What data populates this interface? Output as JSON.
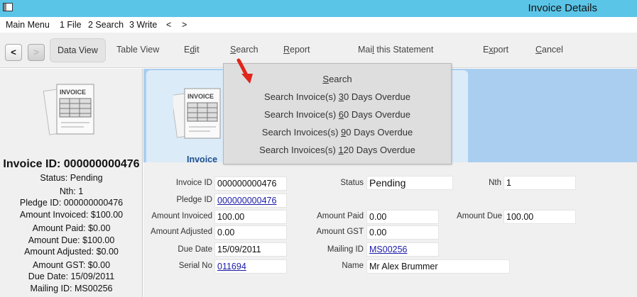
{
  "window": {
    "title": "Invoice Details"
  },
  "menu": [
    {
      "label": "Main Menu"
    },
    {
      "label": "1 File"
    },
    {
      "label": "2 Search"
    },
    {
      "label": "3 Write"
    },
    {
      "label": "<"
    },
    {
      "label": ">"
    }
  ],
  "toolbar": {
    "back": "<",
    "forward": ">",
    "data_view": "Data View",
    "table_view": "Table View",
    "edit_pre": "E",
    "edit_u": "d",
    "edit_post": "it",
    "search_u": "S",
    "search_post": "earch",
    "report_u": "R",
    "report_post": "eport",
    "mail_pre": "Mai",
    "mail_u": "l",
    "mail_post": " this Statement",
    "export_pre": "E",
    "export_u": "x",
    "export_post": "port",
    "cancel_u": "C",
    "cancel_post": "ancel"
  },
  "left_summary": {
    "invoice_id": "Invoice ID: 000000000476",
    "lines": [
      "Status: Pending",
      "Nth: 1",
      "Pledge ID: 000000000476",
      "Amount Invoiced: $100.00",
      "Amount Paid: $0.00",
      "Amount Due: $100.00",
      "Amount Adjusted: $0.00",
      "Amount GST: $0.00",
      "Due Date: 15/09/2011",
      "Mailing ID: MS00256"
    ]
  },
  "tab": {
    "label": "Invoice"
  },
  "icon_text": "INVOICE",
  "form": {
    "invoice_id": {
      "label": "Invoice ID",
      "value": "000000000476"
    },
    "status": {
      "label": "Status",
      "value": "Pending"
    },
    "nth": {
      "label": "Nth",
      "value": "1"
    },
    "pledge_id": {
      "label": "Pledge ID",
      "value": "000000000476"
    },
    "amount_invoiced": {
      "label": "Amount Invoiced",
      "value": "100.00"
    },
    "amount_paid": {
      "label": "Amount Paid",
      "value": "0.00"
    },
    "amount_due": {
      "label": "Amount Due",
      "value": "100.00"
    },
    "amount_adjusted": {
      "label": "Amount Adjusted",
      "value": "0.00"
    },
    "amount_gst": {
      "label": "Amount GST",
      "value": "0.00"
    },
    "due_date": {
      "label": "Due Date",
      "value": "15/09/2011"
    },
    "mailing_id": {
      "label": "Mailing ID",
      "value": "MS00256"
    },
    "serial_no": {
      "label": "Serial No",
      "value": "011694"
    },
    "name": {
      "label": "Name",
      "value": "Mr Alex Brummer"
    }
  },
  "search_menu": [
    {
      "pre": "",
      "u": "S",
      "post": "earch"
    },
    {
      "pre": "Search Invoice(s) ",
      "u": "3",
      "post": "0 Days Overdue"
    },
    {
      "pre": "Search Invoice(s) ",
      "u": "6",
      "post": "0 Days Overdue"
    },
    {
      "pre": "Search Invoices(s) ",
      "u": "9",
      "post": "0 Days Overdue"
    },
    {
      "pre": "Search Invoices(s) ",
      "u": "1",
      "post": "20 Days Overdue"
    }
  ],
  "colors": {
    "titlebar": "#5bc5e8",
    "tab_blue": "#a9cef0",
    "link": "#1a1aa6",
    "arrow": "#e0251b"
  }
}
